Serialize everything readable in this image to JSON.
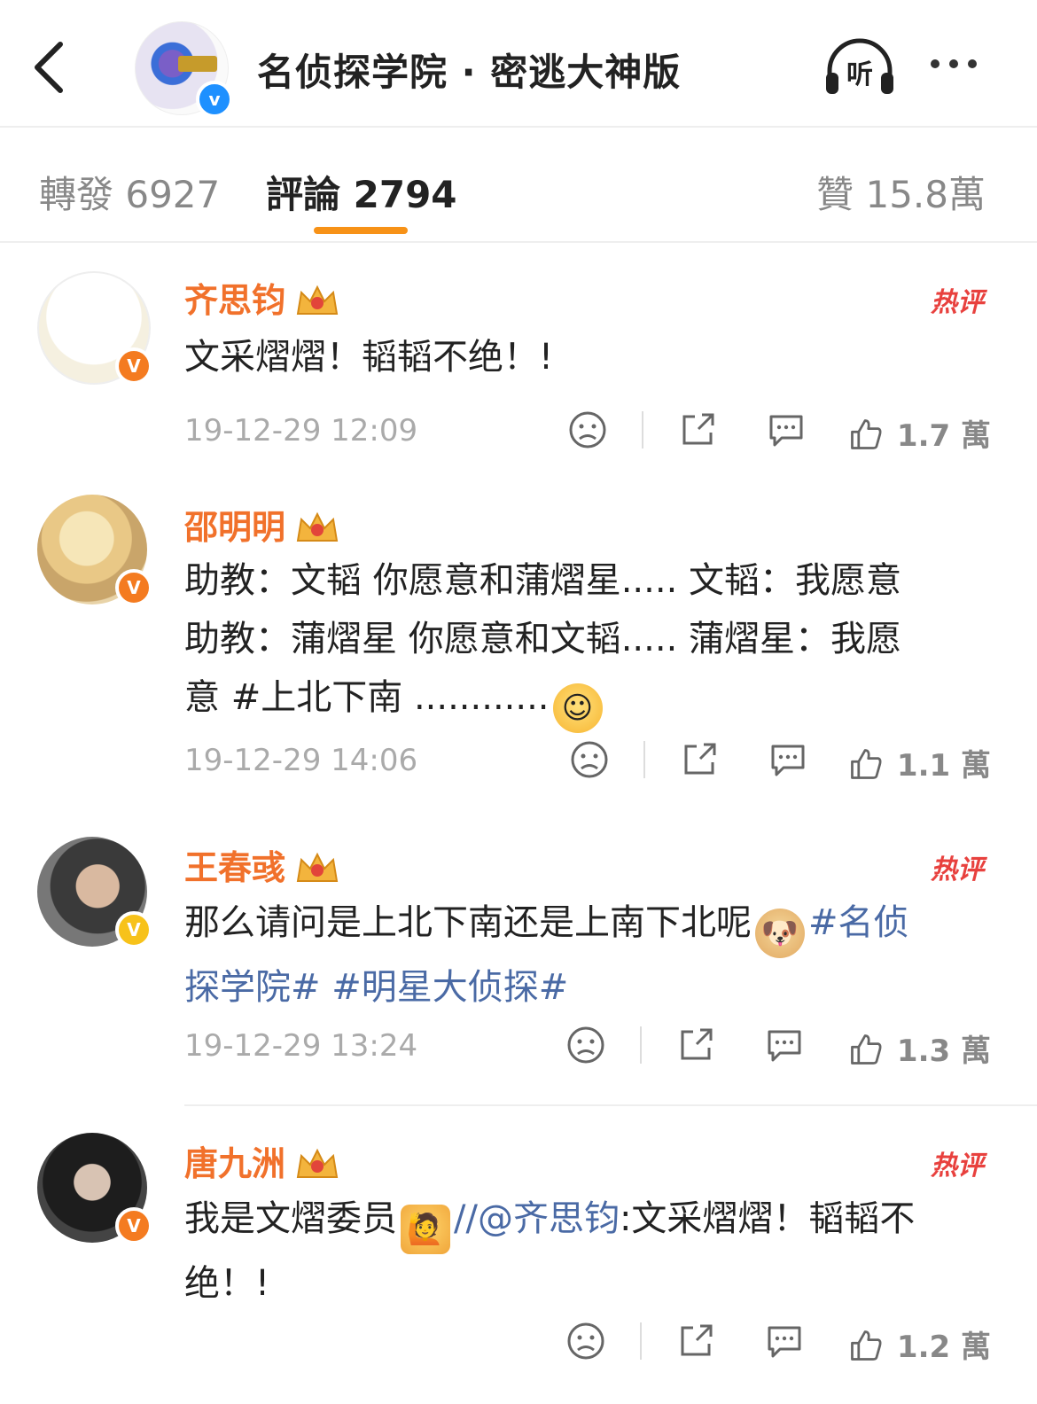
{
  "header": {
    "back_icon": "chevron-left-icon",
    "title": "名侦探学院 · 密逃大神版",
    "listen_label": "听",
    "more_icon": "more-dots-icon"
  },
  "tabs": {
    "repost": "轉發 6927",
    "comments": "評論 2794",
    "likes": "贊 15.8萬",
    "active_color": "#f79217"
  },
  "comments": [
    {
      "name": "齐思钧",
      "crown_level": "9",
      "hot_label": "热评",
      "text": "文采熠熠！韬韬不绝！!",
      "time": "19-12-29 12:09",
      "likes": "1.7 萬",
      "badge_color": "#f47b20"
    },
    {
      "name": "邵明明",
      "crown_level": "7",
      "line1": "助教：文韬 你愿意和蒲熠星.....  文韬：我愿意",
      "line2": "助教：蒲熠星 你愿意和文韬..... 蒲熠星：我愿",
      "line3": "意  #上北下南 ............",
      "time": "19-12-29 14:06",
      "likes": "1.1 萬",
      "badge_color": "#f47b20"
    },
    {
      "name": "王春彧",
      "crown_level": "7",
      "hot_label": "热评",
      "text_plain": "那么请问是上北下南还是上南下北呢",
      "tag1": "#名侦",
      "tag2": "探学院#  #明星大侦探#",
      "time": "19-12-29 13:24",
      "likes": "1.3 萬",
      "badge_color": "#f7c21a"
    },
    {
      "name": "唐九洲",
      "crown_level": "9",
      "hot_label": "热评",
      "text_start": "我是文熠委员",
      "mention": "//@齐思钧",
      "text_rest": ":文采熠熠！韬韬不",
      "line2": "绝！!",
      "likes": "1.2 萬",
      "badge_color": "#f47b20"
    }
  ]
}
